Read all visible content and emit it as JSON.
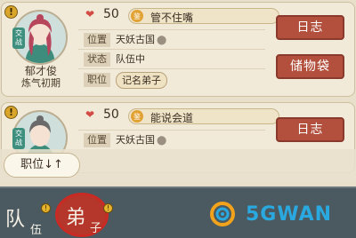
{
  "members": [
    {
      "alert_symbol": "!",
      "sect_badge": "交战",
      "name": "郁才俊",
      "realm": "炼气初期",
      "favor": "50",
      "trait_icon": "鉴",
      "trait": "管不住嘴",
      "fields": [
        {
          "label": "位置",
          "value": "天妖古国"
        },
        {
          "label": "状态",
          "value": "队伍中"
        },
        {
          "label": "职位",
          "value": "记名弟子"
        }
      ],
      "buttons": [
        "日志",
        "储物袋"
      ]
    },
    {
      "alert_symbol": "!",
      "sect_badge": "交战",
      "favor": "50",
      "trait_icon": "鉴",
      "trait": "能说会道",
      "fields": [
        {
          "label": "位置",
          "value": "天妖古国"
        }
      ],
      "buttons": [
        "日志"
      ]
    }
  ],
  "sort_button": "职位↓↑",
  "tabs": [
    {
      "main": "队",
      "sub": "伍",
      "badge": "!"
    },
    {
      "main": "弟",
      "sub": "子",
      "badge": "!"
    }
  ],
  "watermark": "5GWAN",
  "icons": {
    "heart": "heart-icon",
    "location": "location-pin-icon",
    "alert": "alert-icon"
  },
  "colors": {
    "button": "#b24f3d",
    "tabbar": "#4b5a60",
    "highlight_circle": "#c92a24",
    "watermark": "#2aa9e0"
  }
}
